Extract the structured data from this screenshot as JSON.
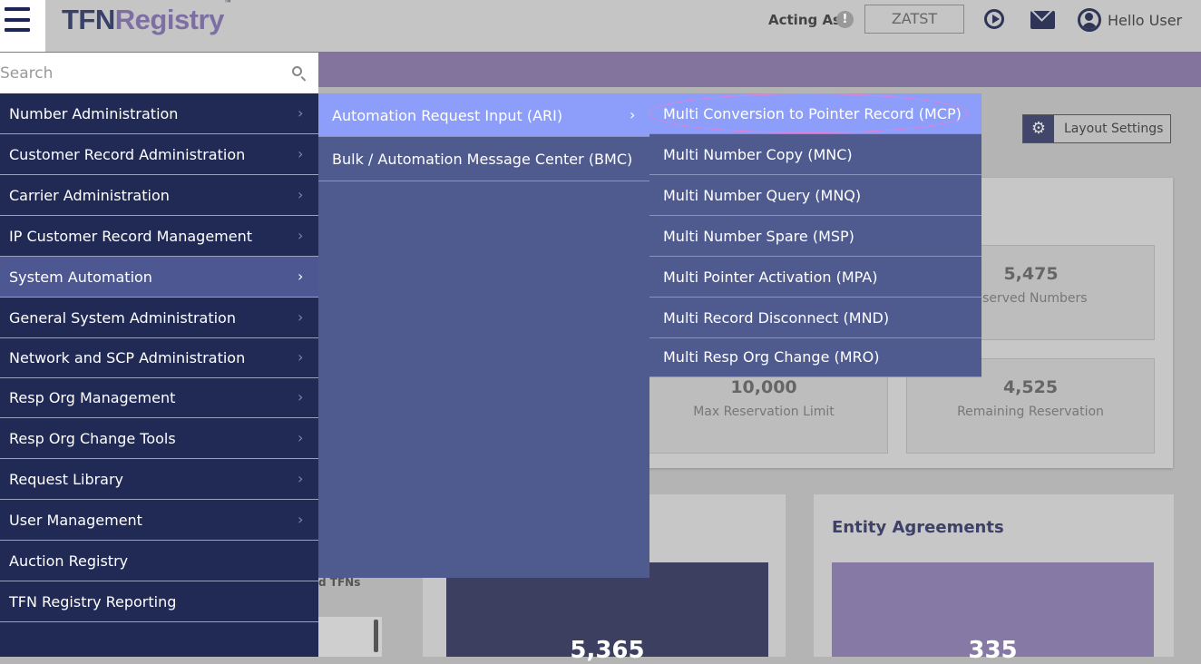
{
  "header": {
    "logo_part1": "TFN",
    "logo_part2": "Registry",
    "logo_tm": "™",
    "acting_as_label": "Acting As",
    "info_icon_glyph": "!",
    "acting_as_value": "ZATST",
    "user_greeting": "Hello User",
    "icons": [
      "hamburger-menu-icon",
      "info-icon",
      "play-circle-icon",
      "mail-icon",
      "user-circle-icon"
    ]
  },
  "search": {
    "placeholder": "Search"
  },
  "menu_level1": {
    "items": [
      {
        "label": "Number Administration",
        "chevron": "›"
      },
      {
        "label": "Customer Record Administration",
        "chevron": "›"
      },
      {
        "label": "Carrier Administration",
        "chevron": "›"
      },
      {
        "label": "IP Customer Record Management",
        "chevron": "›"
      },
      {
        "label": "System Automation",
        "chevron": "›",
        "active": true
      },
      {
        "label": "General System Administration",
        "chevron": "›"
      },
      {
        "label": "Network and SCP Administration",
        "chevron": "›"
      },
      {
        "label": "Resp Org Management",
        "chevron": "›"
      },
      {
        "label": "Resp Org Change Tools",
        "chevron": "›"
      },
      {
        "label": "Request Library",
        "chevron": "›"
      },
      {
        "label": "User Management",
        "chevron": "›"
      },
      {
        "label": "Auction Registry",
        "chevron": ""
      },
      {
        "label": "TFN Registry Reporting",
        "chevron": ""
      }
    ]
  },
  "menu_level2": {
    "items": [
      {
        "label": "Automation Request Input (ARI)",
        "chevron": "›",
        "active": true
      },
      {
        "label": "Bulk / Automation Message Center (BMC)",
        "chevron": ""
      }
    ]
  },
  "menu_level3": {
    "items": [
      {
        "label": "Multi Conversion to Pointer Record (MCP)",
        "active": true
      },
      {
        "label": "Multi Number Copy (MNC)"
      },
      {
        "label": "Multi Number Query (MNQ)"
      },
      {
        "label": "Multi Number Spare (MSP)"
      },
      {
        "label": "Multi Pointer Activation (MPA)"
      },
      {
        "label": "Multi Record Disconnect (MND)"
      },
      {
        "label": "Multi Resp Org Change (MRO)"
      }
    ]
  },
  "dashboard": {
    "layout_settings_label": "Layout Settings",
    "stats": [
      {
        "value": "5,475",
        "caption": "eserved Numbers"
      },
      {
        "value": "10,000",
        "caption": "Max Reservation Limit"
      },
      {
        "value": "4,525",
        "caption": "Remaining Reservation"
      }
    ],
    "left_fragment_text": "d TFNs",
    "left_big_number": "5,365",
    "entity_title": "Entity Agreements",
    "entity_big_number": "335"
  },
  "colors": {
    "menu_dark": "#202a55",
    "menu_mid": "#4f5a8f",
    "menu_active_light": "#8c9ef9",
    "header_purple": "#83749e"
  }
}
